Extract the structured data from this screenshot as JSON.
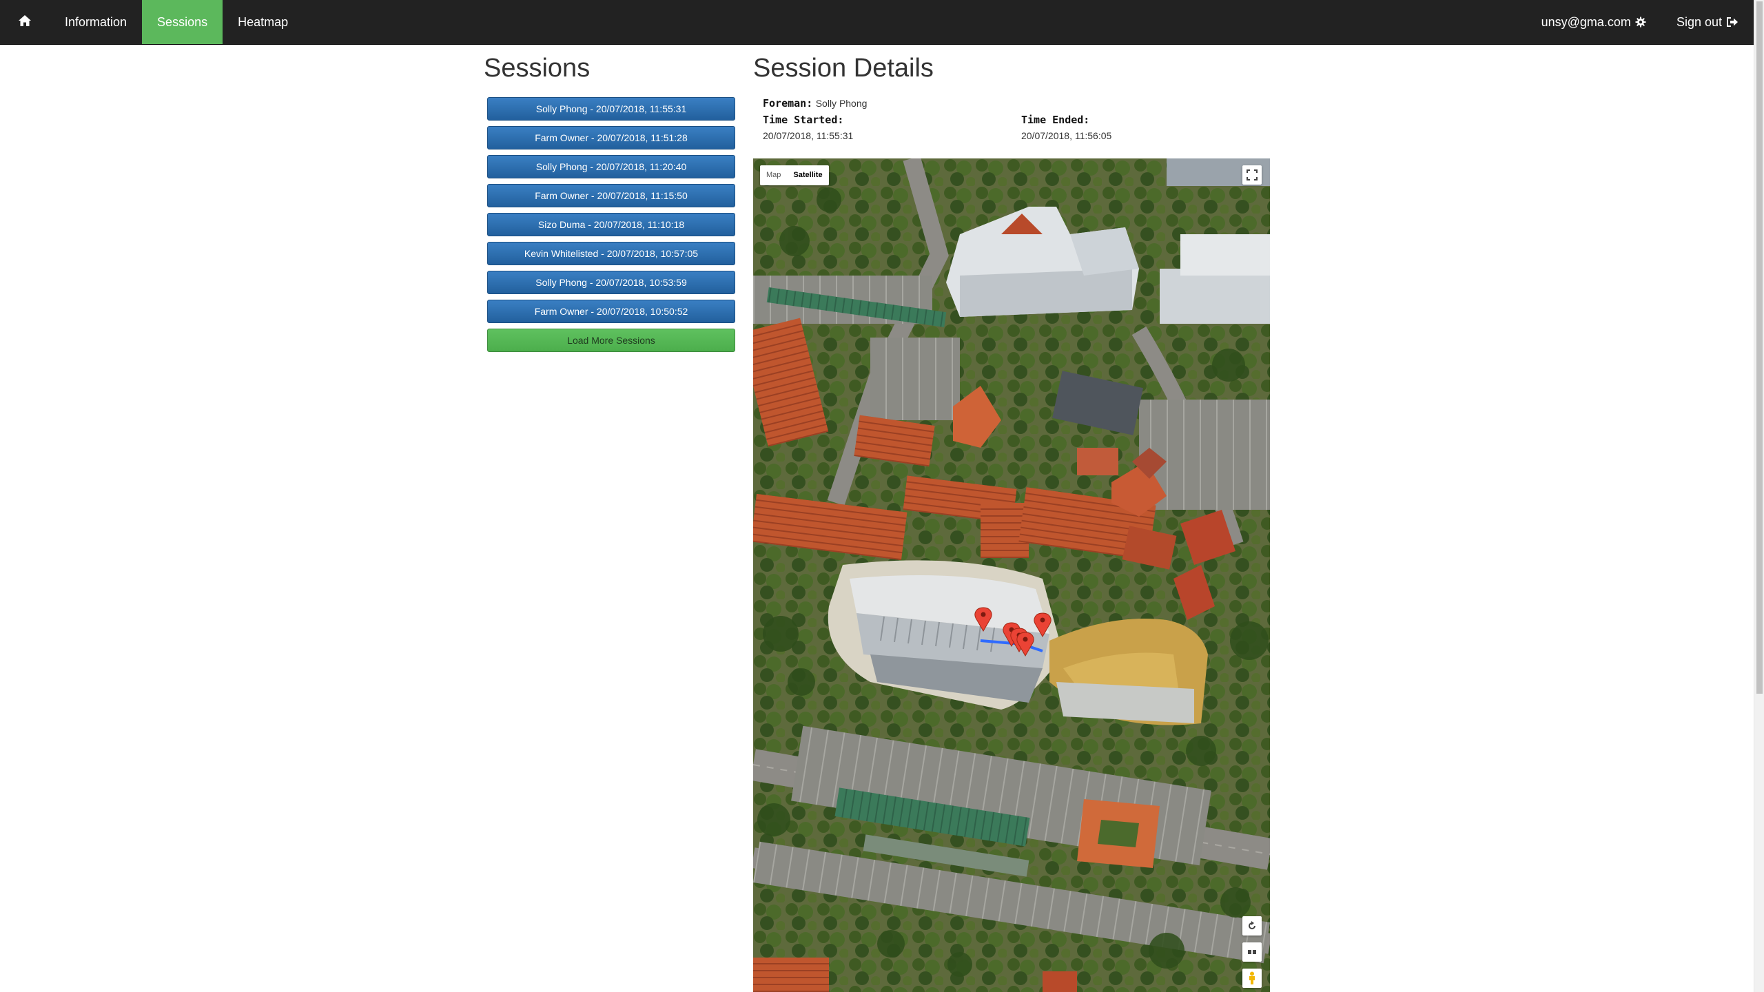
{
  "nav": {
    "home_icon": "home-icon",
    "items": [
      {
        "label": "Information",
        "active": false
      },
      {
        "label": "Sessions",
        "active": true
      },
      {
        "label": "Heatmap",
        "active": false
      }
    ],
    "user": "unsy@gma.com",
    "user_icon": "gear-icon",
    "signout": "Sign out",
    "signout_icon": "sign-out-icon",
    "colors": {
      "bar": "#222222",
      "active": "#5cb85c"
    }
  },
  "sessions": {
    "title": "Sessions",
    "items": [
      "Solly Phong - 20/07/2018, 11:55:31",
      "Farm Owner - 20/07/2018, 11:51:28",
      "Solly Phong - 20/07/2018, 11:20:40",
      "Farm Owner - 20/07/2018, 11:15:50",
      "Sizo Duma - 20/07/2018, 11:10:18",
      "Kevin Whitelisted - 20/07/2018, 10:57:05",
      "Solly Phong - 20/07/2018, 10:53:59",
      "Farm Owner - 20/07/2018, 10:50:52"
    ],
    "load_more": "Load More Sessions",
    "colors": {
      "session_button": "#2a6eb1",
      "load_more_button": "#5cb85c"
    }
  },
  "details": {
    "title": "Session Details",
    "foreman_label": "Foreman:",
    "foreman": "Solly Phong",
    "started_label": "Time Started:",
    "started": "20/07/2018, 11:55:31",
    "ended_label": "Time Ended:",
    "ended": "20/07/2018, 11:56:05"
  },
  "map": {
    "type_options": [
      "Map",
      "Satellite"
    ],
    "selected_type": "Satellite",
    "marker_count": 5,
    "controls": [
      "fullscreen-icon",
      "rotate-icon",
      "tilt-icon",
      "pegman-icon"
    ]
  }
}
